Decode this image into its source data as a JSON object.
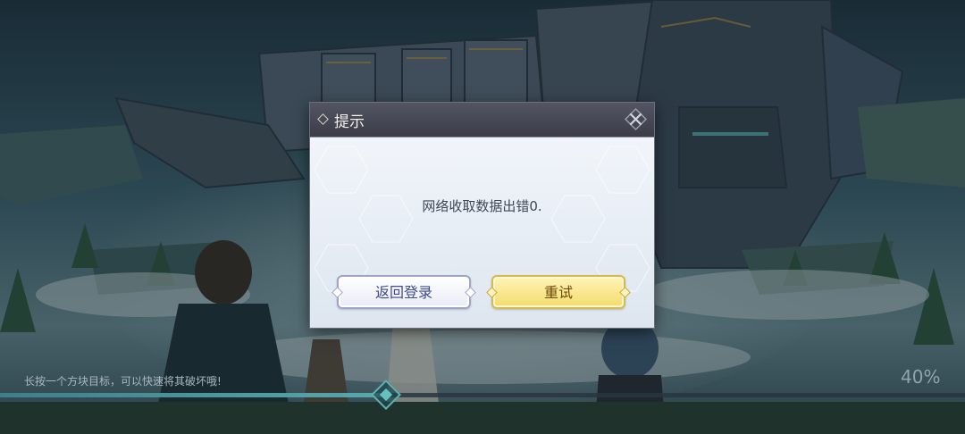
{
  "dialog": {
    "title": "提示",
    "message": "网络收取数据出错0.",
    "back_label": "返回登录",
    "retry_label": "重试"
  },
  "loading": {
    "tip": "长按一个方块目标，可以快速将其破坏哦!",
    "percent_label": "40%",
    "progress": 0.4
  },
  "colors": {
    "header_bg": "#4a4b58",
    "body_bg": "#e7eef5",
    "back_button": "#f2f4fa",
    "retry_button": "#f7e58c",
    "progress_fill": "#4f9ea3"
  },
  "icons": {
    "title_icon": "diamond-icon",
    "close_icon": "close-icon"
  }
}
